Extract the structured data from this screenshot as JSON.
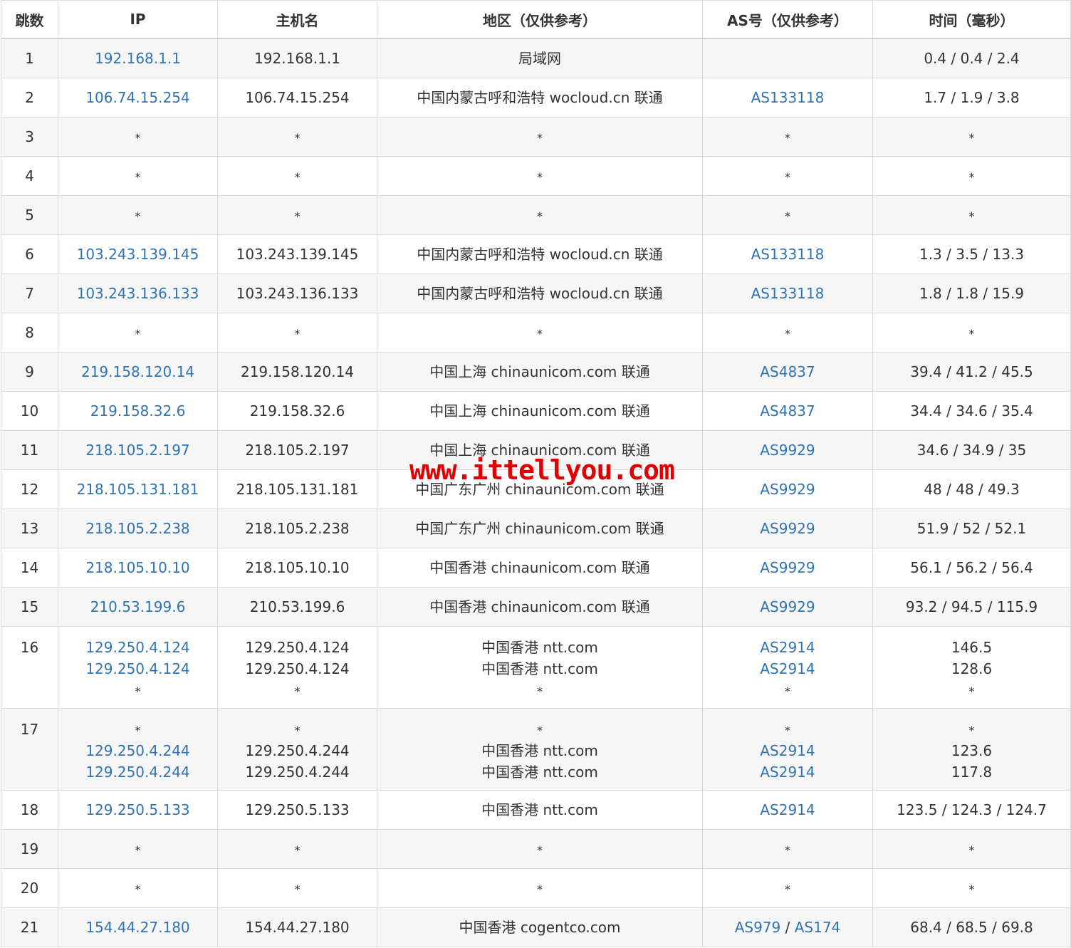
{
  "headers": [
    "跳数",
    "IP",
    "主机名",
    "地区（仅供参考）",
    "AS号（仅供参考）",
    "时间（毫秒）"
  ],
  "rows": [
    {
      "hop": "1",
      "entries": [
        {
          "ip": "192.168.1.1",
          "host": "192.168.1.1",
          "region": "局域网",
          "as": [],
          "time": "0.4 / 0.4 / 2.4"
        }
      ]
    },
    {
      "hop": "2",
      "entries": [
        {
          "ip": "106.74.15.254",
          "host": "106.74.15.254",
          "region": "中国内蒙古呼和浩特 wocloud.cn 联通",
          "as": [
            "AS133118"
          ],
          "time": "1.7 / 1.9 / 3.8"
        }
      ]
    },
    {
      "hop": "3",
      "entries": [
        {
          "ip": "*",
          "host": "*",
          "region": "*",
          "as": [
            "*"
          ],
          "time": "*"
        }
      ]
    },
    {
      "hop": "4",
      "entries": [
        {
          "ip": "*",
          "host": "*",
          "region": "*",
          "as": [
            "*"
          ],
          "time": "*"
        }
      ]
    },
    {
      "hop": "5",
      "entries": [
        {
          "ip": "*",
          "host": "*",
          "region": "*",
          "as": [
            "*"
          ],
          "time": "*"
        }
      ]
    },
    {
      "hop": "6",
      "entries": [
        {
          "ip": "103.243.139.145",
          "host": "103.243.139.145",
          "region": "中国内蒙古呼和浩特 wocloud.cn 联通",
          "as": [
            "AS133118"
          ],
          "time": "1.3 / 3.5 / 13.3"
        }
      ]
    },
    {
      "hop": "7",
      "entries": [
        {
          "ip": "103.243.136.133",
          "host": "103.243.136.133",
          "region": "中国内蒙古呼和浩特 wocloud.cn 联通",
          "as": [
            "AS133118"
          ],
          "time": "1.8 / 1.8 / 15.9"
        }
      ]
    },
    {
      "hop": "8",
      "entries": [
        {
          "ip": "*",
          "host": "*",
          "region": "*",
          "as": [
            "*"
          ],
          "time": "*"
        }
      ]
    },
    {
      "hop": "9",
      "entries": [
        {
          "ip": "219.158.120.14",
          "host": "219.158.120.14",
          "region": "中国上海 chinaunicom.com 联通",
          "as": [
            "AS4837"
          ],
          "time": "39.4 / 41.2 / 45.5"
        }
      ]
    },
    {
      "hop": "10",
      "entries": [
        {
          "ip": "219.158.32.6",
          "host": "219.158.32.6",
          "region": "中国上海 chinaunicom.com 联通",
          "as": [
            "AS4837"
          ],
          "time": "34.4 / 34.6 / 35.4"
        }
      ]
    },
    {
      "hop": "11",
      "entries": [
        {
          "ip": "218.105.2.197",
          "host": "218.105.2.197",
          "region": "中国上海 chinaunicom.com 联通",
          "as": [
            "AS9929"
          ],
          "time": "34.6 / 34.9 / 35"
        }
      ]
    },
    {
      "hop": "12",
      "entries": [
        {
          "ip": "218.105.131.181",
          "host": "218.105.131.181",
          "region": "中国广东广州 chinaunicom.com 联通",
          "as": [
            "AS9929"
          ],
          "time": "48 / 48 / 49.3"
        }
      ]
    },
    {
      "hop": "13",
      "entries": [
        {
          "ip": "218.105.2.238",
          "host": "218.105.2.238",
          "region": "中国广东广州 chinaunicom.com 联通",
          "as": [
            "AS9929"
          ],
          "time": "51.9 / 52 / 52.1"
        }
      ]
    },
    {
      "hop": "14",
      "entries": [
        {
          "ip": "218.105.10.10",
          "host": "218.105.10.10",
          "region": "中国香港 chinaunicom.com 联通",
          "as": [
            "AS9929"
          ],
          "time": "56.1 / 56.2 / 56.4"
        }
      ]
    },
    {
      "hop": "15",
      "entries": [
        {
          "ip": "210.53.199.6",
          "host": "210.53.199.6",
          "region": "中国香港 chinaunicom.com 联通",
          "as": [
            "AS9929"
          ],
          "time": "93.2 / 94.5 / 115.9"
        }
      ]
    },
    {
      "hop": "16",
      "entries": [
        {
          "ip": "129.250.4.124",
          "host": "129.250.4.124",
          "region": "中国香港 ntt.com",
          "as": [
            "AS2914"
          ],
          "time": "146.5"
        },
        {
          "ip": "129.250.4.124",
          "host": "129.250.4.124",
          "region": "中国香港 ntt.com",
          "as": [
            "AS2914"
          ],
          "time": "128.6"
        },
        {
          "ip": "*",
          "host": "*",
          "region": "*",
          "as": [
            "*"
          ],
          "time": "*"
        }
      ]
    },
    {
      "hop": "17",
      "entries": [
        {
          "ip": "*",
          "host": "*",
          "region": "*",
          "as": [
            "*"
          ],
          "time": "*"
        },
        {
          "ip": "129.250.4.244",
          "host": "129.250.4.244",
          "region": "中国香港 ntt.com",
          "as": [
            "AS2914"
          ],
          "time": "123.6"
        },
        {
          "ip": "129.250.4.244",
          "host": "129.250.4.244",
          "region": "中国香港 ntt.com",
          "as": [
            "AS2914"
          ],
          "time": "117.8"
        }
      ]
    },
    {
      "hop": "18",
      "entries": [
        {
          "ip": "129.250.5.133",
          "host": "129.250.5.133",
          "region": "中国香港 ntt.com",
          "as": [
            "AS2914"
          ],
          "time": "123.5 / 124.3 / 124.7"
        }
      ]
    },
    {
      "hop": "19",
      "entries": [
        {
          "ip": "*",
          "host": "*",
          "region": "*",
          "as": [
            "*"
          ],
          "time": "*"
        }
      ]
    },
    {
      "hop": "20",
      "entries": [
        {
          "ip": "*",
          "host": "*",
          "region": "*",
          "as": [
            "*"
          ],
          "time": "*"
        }
      ]
    },
    {
      "hop": "21",
      "entries": [
        {
          "ip": "154.44.27.180",
          "host": "154.44.27.180",
          "region": "中国香港 cogentco.com",
          "as": [
            "AS979",
            "AS174"
          ],
          "time": "68.4 / 68.5 / 69.8"
        }
      ]
    }
  ],
  "as_separator": " / ",
  "watermark": "www.ittellyou.com",
  "colors": {
    "link": "#2f73b3",
    "text": "#333333",
    "border": "#dcdcdc",
    "stripe": "#f6f6f6",
    "watermark": "#e00000"
  }
}
